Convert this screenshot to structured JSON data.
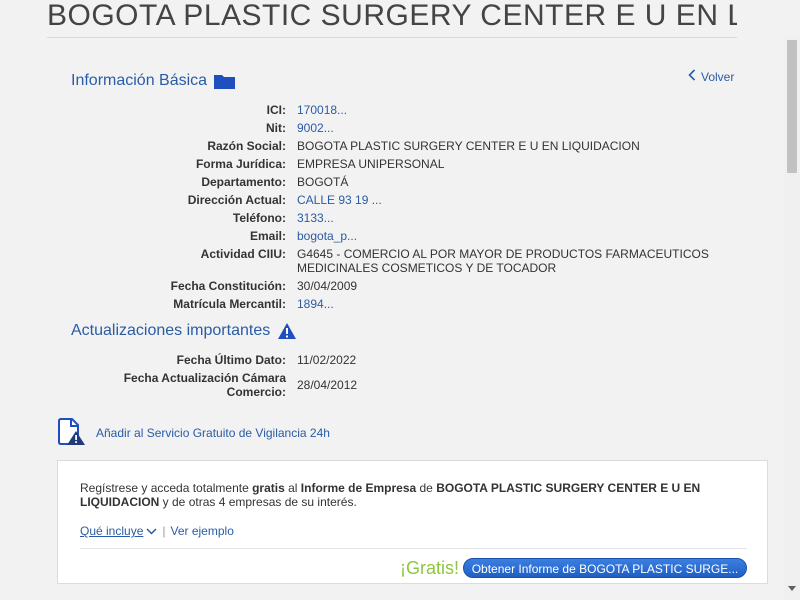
{
  "page": {
    "title": "BOGOTA PLASTIC SURGERY CENTER E U EN LI..."
  },
  "basic_info": {
    "heading": "Información Básica",
    "icon": "folder-icon",
    "back_label": "Volver",
    "fields": [
      {
        "label": "ICI:",
        "value": "170018..."
      },
      {
        "label": "Nit:",
        "value": "9002..."
      },
      {
        "label": "Razón Social:",
        "value": "BOGOTA PLASTIC SURGERY CENTER E U EN LIQUIDACION"
      },
      {
        "label": "Forma Jurídica:",
        "value": "EMPRESA UNIPERSONAL"
      },
      {
        "label": "Departamento:",
        "value": "BOGOTÁ"
      },
      {
        "label": "Dirección Actual:",
        "value": "CALLE 93 19 ..."
      },
      {
        "label": "Teléfono:",
        "value": "3133..."
      },
      {
        "label": "Email:",
        "value": "bogota_p..."
      },
      {
        "label": "Actividad CIIU:",
        "value": "G4645 - COMERCIO AL POR MAYOR DE PRODUCTOS FARMACEUTICOS MEDICINALES COSMETICOS Y DE TOCADOR"
      },
      {
        "label": "Fecha Constitución:",
        "value": "30/04/2009"
      },
      {
        "label": "Matrícula Mercantil:",
        "value": "1894..."
      }
    ]
  },
  "updates": {
    "heading": "Actualizaciones importantes",
    "icon": "warning-icon",
    "fields": [
      {
        "label": "Fecha Último Dato:",
        "value": "11/02/2022"
      },
      {
        "label_line1": "Fecha Actualización Cámara",
        "label_line2": "Comercio:",
        "value": "28/04/2012"
      }
    ]
  },
  "vigilancia": {
    "label": "Añadir al Servicio Gratuito de Vigilancia 24h",
    "icon": "document-alert-icon"
  },
  "promo": {
    "text_1": "Regístrese y acceda totalmente ",
    "text_bold_1": "gratis",
    "text_2": " al ",
    "text_bold_2": "Informe de Empresa",
    "text_3": " de ",
    "text_bold_3": "BOGOTA PLASTIC SURGERY CENTER E U EN LIQUIDACION",
    "text_4": " y de otras 4 empresas de su interés.",
    "incluye_label": "Qué incluye",
    "separator": "|",
    "ejemplo_label": "Ver ejemplo",
    "gratis_label": "¡Gratis!",
    "button_label": "Obtener Informe de BOGOTA PLASTIC SURGE..."
  },
  "colors": {
    "link": "#2a5ca6",
    "gratis": "#8dc63f",
    "button": "#2a6fd6",
    "background": "#f2f2f2"
  }
}
